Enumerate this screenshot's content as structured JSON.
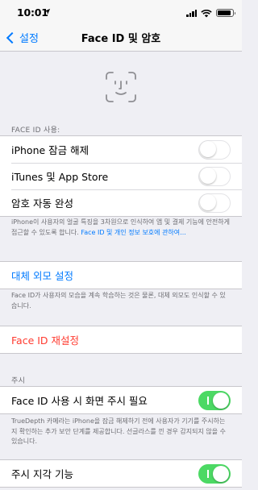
{
  "status": {
    "time": "10:01",
    "location_arrow": "location-arrow-icon"
  },
  "nav": {
    "back_label": "설정",
    "title": "Face ID 및 암호"
  },
  "face_id_section": {
    "header": "FACE ID 사용:",
    "rows": [
      {
        "label": "iPhone 잠금 해제",
        "enabled": false
      },
      {
        "label": "iTunes 및 App Store",
        "enabled": false
      },
      {
        "label": "암호 자동 완성",
        "enabled": false
      }
    ],
    "footer_text": "iPhone이 사용자의 얼굴 특징을 3차원으로 인식하여 앱 및 결제 기능에 안전하게 접근할 수 있도록 합니다. ",
    "footer_link": "Face ID 및 개인 정보 보호에 관하여..."
  },
  "alternate": {
    "label": "대체 외모 설정",
    "footer": "Face ID가 사용자의 모습을 계속 학습하는 것은 물론, 대체 외모도 인식할 수 있습니다."
  },
  "reset": {
    "label": "Face ID 재설정"
  },
  "attention_section": {
    "header": "주시",
    "require_label": "Face ID 사용 시 화면 주시 필요",
    "require_enabled": true,
    "footer": "TrueDepth 카메라는 iPhone을 잠금 해제하기 전에 사용자가 기기를 주시하는지 확인하는 추가 보안 단계를 제공합니다. 선글라스를 낀 경우 감지되지 않을 수 있습니다.",
    "aware_label": "주시 지각 기능",
    "aware_enabled": true
  },
  "colors": {
    "accent": "#007aff",
    "destructive": "#ff3b30",
    "toggle_on": "#4cd964",
    "background": "#efeff4"
  }
}
